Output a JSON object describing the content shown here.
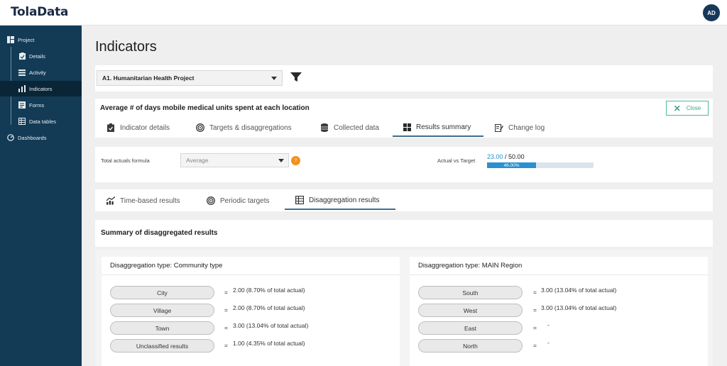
{
  "app": {
    "logo": "TolaData",
    "avatar_initials": "AD"
  },
  "sidebar": {
    "items": [
      {
        "label": "Project",
        "icon": "project-icon",
        "level": "top"
      },
      {
        "label": "Details",
        "icon": "clipboard-icon",
        "level": "sub"
      },
      {
        "label": "Activity",
        "icon": "activity-icon",
        "level": "sub"
      },
      {
        "label": "Indicators",
        "icon": "bar-chart-icon",
        "level": "sub",
        "active": true
      },
      {
        "label": "Forms",
        "icon": "form-icon",
        "level": "sub"
      },
      {
        "label": "Data tables",
        "icon": "table-icon",
        "level": "sub"
      },
      {
        "label": "Dashboards",
        "icon": "dashboard-icon",
        "level": "top"
      }
    ]
  },
  "page": {
    "title": "Indicators"
  },
  "filter": {
    "selected_project": "A1. Humanitarian Health Project"
  },
  "indicator": {
    "name": "Average # of days mobile medical units spent at each location",
    "close_label": "Close",
    "tabs": [
      {
        "label": "Indicator details",
        "icon": "clipboard-check-icon"
      },
      {
        "label": "Targets & disaggregations",
        "icon": "target-icon"
      },
      {
        "label": "Collected data",
        "icon": "database-icon"
      },
      {
        "label": "Results summary",
        "icon": "grid-icon",
        "active": true
      },
      {
        "label": "Change log",
        "icon": "edit-log-icon"
      }
    ]
  },
  "summary": {
    "formula_label": "Total actuals formula",
    "formula_value": "Average",
    "help_glyph": "?",
    "avt_label": "Actual vs Target",
    "actual": "23.00",
    "target": "/ 50.00",
    "percent_label": "46.00%",
    "percent": 46
  },
  "results_tabs": [
    {
      "label": "Time-based results",
      "icon": "trend-chart-icon"
    },
    {
      "label": "Periodic targets",
      "icon": "target-icon"
    },
    {
      "label": "Disaggregation results",
      "icon": "table-icon",
      "active": true
    }
  ],
  "disaggregation": {
    "section_title": "Summary of disaggregated results",
    "eq": "=",
    "groups": [
      {
        "title": "Disaggregation type: Community type",
        "rows": [
          {
            "label": "City",
            "value": "2.00",
            "share": "(8.70% of total actual)"
          },
          {
            "label": "Village",
            "value": "2.00",
            "share": "(8.70% of total actual)"
          },
          {
            "label": "Town",
            "value": "3.00",
            "share": "(13.04% of total actual)"
          },
          {
            "label": "Unclassified results",
            "value": "1.00",
            "share": "(4.35% of total actual)"
          }
        ]
      },
      {
        "title": "Disaggregation type: MAIN Region",
        "rows": [
          {
            "label": "South",
            "value": "3.00",
            "share": "(13.04% of total actual)"
          },
          {
            "label": "West",
            "value": "3.00",
            "share": "(13.04% of total actual)"
          },
          {
            "label": "East",
            "value": "-",
            "share": ""
          },
          {
            "label": "North",
            "value": "-",
            "share": ""
          }
        ]
      }
    ]
  },
  "colors": {
    "sidebar": "#133b55",
    "accent": "#2a90cf",
    "close": "#3aa889",
    "help": "#f0921e"
  }
}
